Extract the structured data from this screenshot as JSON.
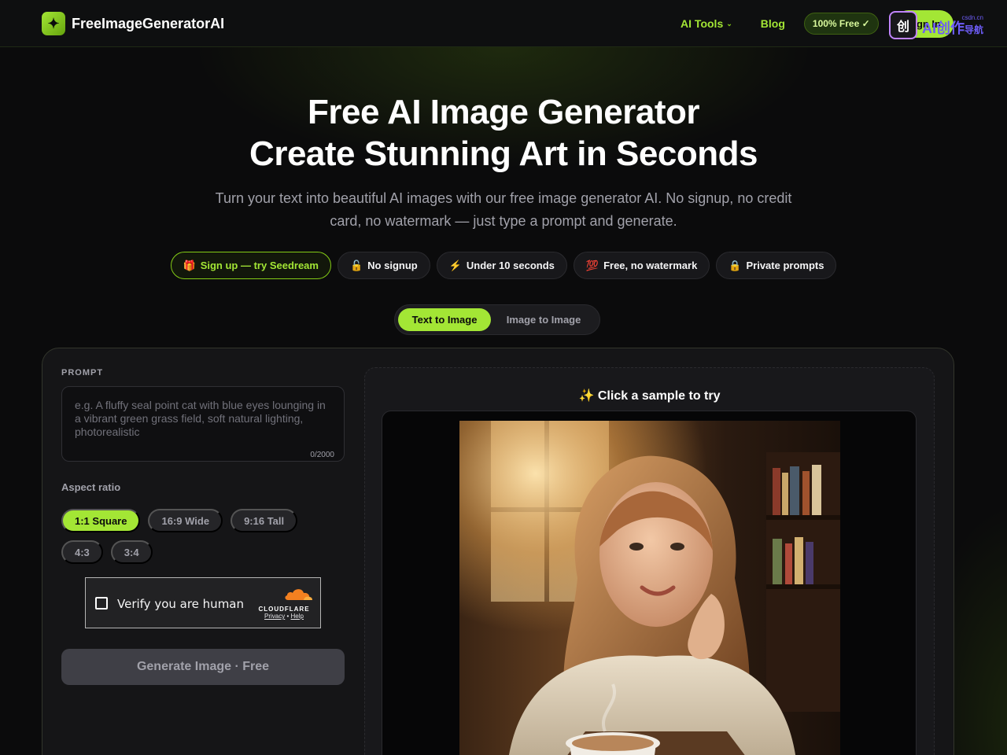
{
  "header": {
    "brand": "FreeImageGeneratorAI",
    "logo_icon": "sparkle-icon",
    "nav": {
      "ai_tools": "AI Tools",
      "blog": "Blog"
    },
    "free_badge": "100% Free ✓",
    "signin_label": "Sign In"
  },
  "overlay": {
    "main": "AI创作",
    "sub": "导航",
    "tiny": "csdn.cn"
  },
  "hero": {
    "title_line1": "Free AI Image Generator",
    "title_line2": "Create Stunning Art in Seconds",
    "subtitle": "Turn your text into beautiful AI images with our free image generator AI. No signup, no credit card, no watermark — just type a prompt and generate."
  },
  "pills": [
    {
      "icon": "🎁",
      "label": "Sign up — try Seedream"
    },
    {
      "icon": "🔓",
      "label": "No signup"
    },
    {
      "icon": "⚡",
      "label": "Under 10 seconds"
    },
    {
      "icon": "💯",
      "label": "Free, no watermark"
    },
    {
      "icon": "🔒",
      "label": "Private prompts"
    }
  ],
  "tabs": {
    "active": "Text to Image",
    "inactive": "Image to Image"
  },
  "form": {
    "prompt_label": "PROMPT",
    "prompt_placeholder": "e.g. A fluffy seal point cat with blue eyes lounging in a vibrant green grass field, soft natural lighting, photorealistic",
    "prompt_value": "",
    "char_count": "0/2000",
    "aspect_label": "Aspect ratio",
    "aspects": [
      "1:1 Square",
      "16:9 Wide",
      "9:16 Tall",
      "4:3",
      "3:4"
    ],
    "aspect_selected": "1:1 Square",
    "captcha_label": "Verify you are human",
    "captcha_brand": "CLOUDFLARE",
    "captcha_privacy": "Privacy",
    "captcha_sep": "•",
    "captcha_help": "Help",
    "generate_label": "Generate Image · Free"
  },
  "preview": {
    "title": "✨ Click a sample to try",
    "sample_alt": "Smiling woman in cream sweater with coffee cup in a sunlit cafe"
  },
  "colors": {
    "accent": "#a3e635",
    "background": "#0b0b0c",
    "panel": "#151517"
  }
}
